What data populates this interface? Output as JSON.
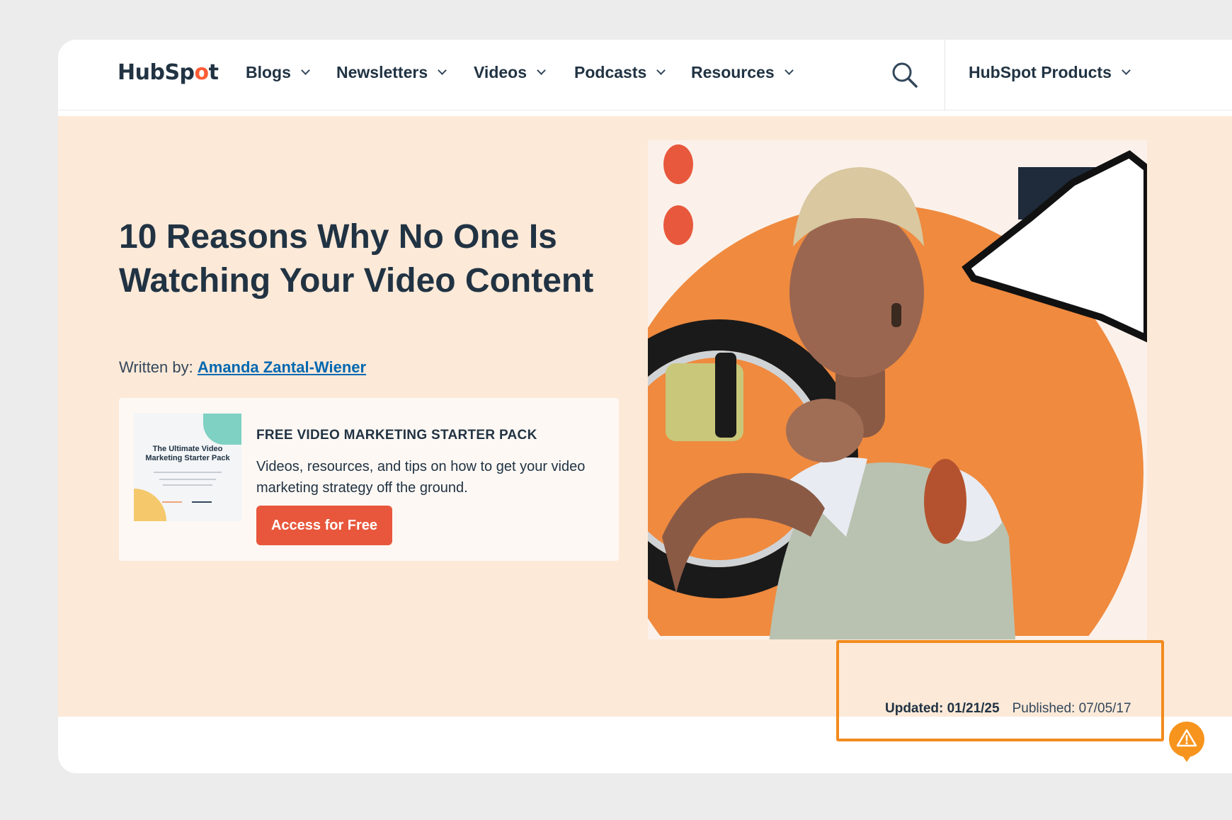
{
  "nav": {
    "logo_prefix": "HubSp",
    "logo_accent": "o",
    "logo_suffix": "t",
    "items": [
      {
        "label": "Blogs"
      },
      {
        "label": "Newsletters"
      },
      {
        "label": "Videos"
      },
      {
        "label": "Podcasts"
      },
      {
        "label": "Resources"
      }
    ],
    "search_icon": "search-icon",
    "products_label": "HubSpot Products"
  },
  "article": {
    "title": "10 Reasons Why No One Is Watching Your Video Content",
    "byline_prefix": "Written by:",
    "author": "Amanda Zantal-Wiener",
    "updated_label": "Updated: 01/21/25",
    "published_label": "Published: 07/05/17"
  },
  "offer": {
    "thumbnail_title": "The Ultimate Video Marketing Starter Pack",
    "heading": "FREE VIDEO MARKETING STARTER PACK",
    "description": "Videos, resources, and tips on how to get your video marketing strategy off the ground.",
    "cta_label": "Access for Free"
  },
  "colors": {
    "brand": "#ff5c35",
    "cta": "#e8573c",
    "hero_bg": "#fce9d8",
    "link": "#0068b1",
    "highlight": "#f28b1e",
    "text": "#213343"
  },
  "icons": {
    "alert": "warning-icon",
    "dropdown": "chevron-down-icon"
  }
}
